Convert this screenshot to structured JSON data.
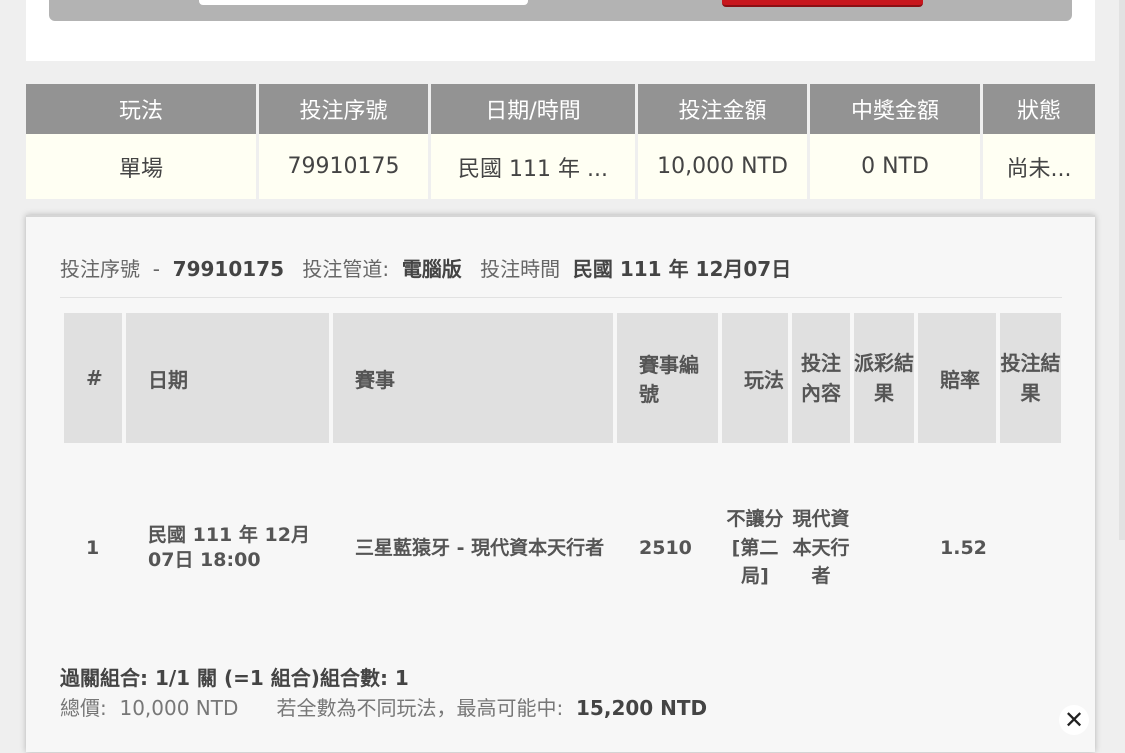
{
  "summary": {
    "headers": [
      "玩法",
      "投注序號",
      "日期/時間",
      "投注金額",
      "中獎金額",
      "狀態"
    ],
    "row": [
      "單場",
      "79910175",
      "民國 111 年 ...",
      "10,000 NTD",
      "0 NTD",
      "尚未..."
    ]
  },
  "detail": {
    "serial_label": "投注序號",
    "serial_sep": "-",
    "serial_value": "79910175",
    "channel_label": "投注管道:",
    "channel_value": "電腦版",
    "time_label": "投注時間",
    "time_value": "民國 111 年 12月07日",
    "table": {
      "headers": [
        "#",
        "日期",
        "賽事",
        "賽事編號",
        "玩法",
        "投注內容",
        "派彩結果",
        "賠率",
        "投注結果"
      ],
      "row": [
        "1",
        "民國 111 年 12月07日 18:00",
        "三星藍猿牙 - 現代資本天行者",
        "2510",
        "不讓分[第二局]",
        "現代資本天行者",
        "",
        "1.52",
        ""
      ]
    },
    "combo_text": "過關組合: 1/1 關 (=1 組合)組合數: 1",
    "total_label": "總價:",
    "total_value": "10,000 NTD",
    "max_label": "若全數為不同玩法，最高可能中:",
    "max_value": "15,200 NTD",
    "close_icon": "close-icon"
  }
}
